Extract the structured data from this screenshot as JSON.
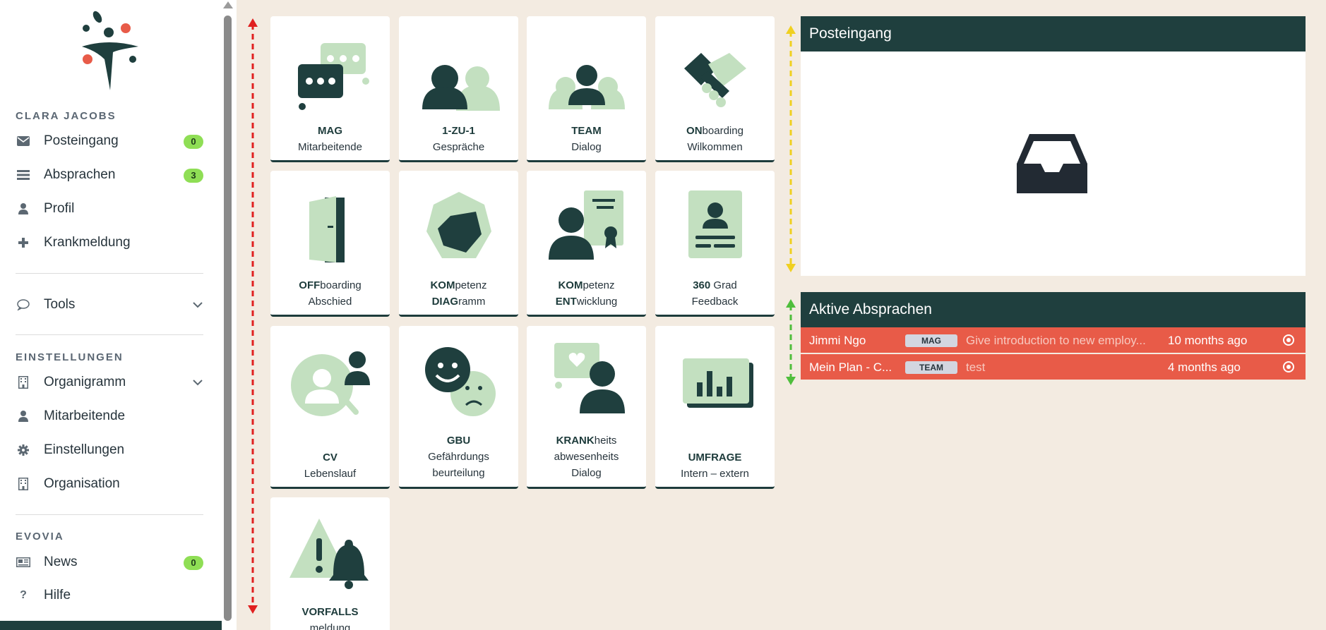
{
  "sidebar": {
    "user_name": "CLARA JACOBS",
    "items": [
      {
        "label": "Posteingang",
        "icon": "envelope-icon",
        "badge": "0"
      },
      {
        "label": "Absprachen",
        "icon": "list-icon",
        "badge": "3"
      },
      {
        "label": "Profil",
        "icon": "user-icon"
      },
      {
        "label": "Krankmeldung",
        "icon": "plus-icon"
      }
    ],
    "tools_label": "Tools",
    "settings_title": "EINSTELLUNGEN",
    "settings_items": [
      {
        "label": "Organigramm",
        "icon": "building-icon"
      },
      {
        "label": "Mitarbeitende",
        "icon": "user-icon"
      },
      {
        "label": "Einstellungen",
        "icon": "gear-icon"
      },
      {
        "label": "Organisation",
        "icon": "building-icon"
      }
    ],
    "evovia_title": "EVOVIA",
    "evovia_items": [
      {
        "label": "News",
        "icon": "newspaper-icon",
        "badge": "0"
      },
      {
        "label": "Hilfe",
        "icon": "question-icon"
      }
    ]
  },
  "tiles": [
    {
      "bold": "MAG",
      "rest": "",
      "line2": "Mitarbeitende",
      "icon": "chat-bubbles-icon"
    },
    {
      "bold": "1-ZU-1",
      "rest": "",
      "line2": "Gespräche",
      "icon": "two-people-icon"
    },
    {
      "bold": "TEAM",
      "rest": "",
      "line2": "Dialog",
      "icon": "team-icon"
    },
    {
      "bold": "ON",
      "rest": "boarding",
      "line2": "Wilkommen",
      "icon": "handshake-icon"
    },
    {
      "bold": "OFF",
      "rest": "boarding",
      "line2": "Abschied",
      "icon": "door-icon"
    },
    {
      "bold": "KOM",
      "rest": "petenz",
      "line2bold": "DIAG",
      "line2rest": "ramm",
      "icon": "radar-diagram-icon"
    },
    {
      "bold": "KOM",
      "rest": "petenz",
      "line2bold": "ENT",
      "line2rest": "wicklung",
      "icon": "certificate-icon"
    },
    {
      "bold": "360",
      "rest": " Grad",
      "line2": "Feedback",
      "icon": "profile-card-icon"
    },
    {
      "bold": "CV",
      "rest": "",
      "line2": "Lebenslauf",
      "icon": "search-person-icon"
    },
    {
      "bold": "GBU",
      "rest": "",
      "line2": "Gefährdungs",
      "line3": "beurteilung",
      "icon": "smiley-faces-icon"
    },
    {
      "bold": "KRANK",
      "rest": "heits",
      "line2": "abwesenheits",
      "line3": "Dialog",
      "icon": "person-heart-icon"
    },
    {
      "bold": "UMFRAGE",
      "rest": "",
      "line2": "Intern – extern",
      "icon": "bar-chart-icon"
    },
    {
      "bold": "VORFALLS",
      "rest": "",
      "line2": "meldung",
      "icon": "warning-bell-icon"
    }
  ],
  "inbox": {
    "title": "Posteingang",
    "empty_icon": "inbox-tray-icon"
  },
  "agreements": {
    "title": "Aktive Absprachen",
    "rows": [
      {
        "name": "Jimmi Ngo",
        "tag": "MAG",
        "desc": "Give introduction to new employ...",
        "time": "10 months ago"
      },
      {
        "name": "Mein Plan - C...",
        "tag": "TEAM",
        "desc": "test",
        "time": "4 months ago"
      }
    ]
  },
  "colors": {
    "brand_dark": "#1f3f3e",
    "brand_light": "#c3e0c0",
    "accent_red": "#e85b48",
    "badge_green": "#8fde55",
    "background": "#f3ebe1"
  }
}
